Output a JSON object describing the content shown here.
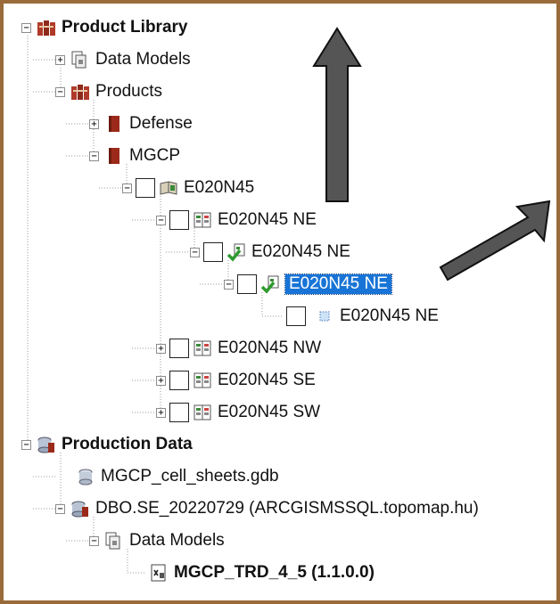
{
  "tree": {
    "items": [
      {
        "label": "Product Library",
        "expander": "−",
        "icon": "library-icon"
      },
      {
        "label": "Data Models",
        "expander": "+",
        "icon": "data-models-icon"
      },
      {
        "label": "Products",
        "expander": "−",
        "icon": "library-icon"
      },
      {
        "label": "Defense",
        "expander": "+",
        "icon": "book-icon"
      },
      {
        "label": "MGCP",
        "expander": "−",
        "icon": "book-icon"
      },
      {
        "label": "E020N45",
        "expander": "−",
        "icon": "series-book-icon",
        "checked": false
      },
      {
        "label": "E020N45 NE",
        "expander": "−",
        "icon": "map-sheet-icon",
        "checked": false
      },
      {
        "label": "E020N45 NE",
        "expander": "−",
        "icon": "instance-check-icon",
        "checked": false
      },
      {
        "label": "E020N45 NE",
        "expander": "−",
        "icon": "instance-check-icon",
        "checked": false,
        "selected": true
      },
      {
        "label": "E020N45 NE",
        "expander": "",
        "icon": "dotted-square-icon",
        "checked": false
      },
      {
        "label": "E020N45 NW",
        "expander": "+",
        "icon": "map-sheet-icon",
        "checked": false
      },
      {
        "label": "E020N45 SE",
        "expander": "+",
        "icon": "map-sheet-icon",
        "checked": false
      },
      {
        "label": "E020N45 SW",
        "expander": "+",
        "icon": "map-sheet-icon",
        "checked": false
      },
      {
        "label": "Production Data",
        "expander": "−",
        "icon": "database-stack-icon"
      },
      {
        "label": "MGCP_cell_sheets.gdb",
        "expander": "",
        "icon": "geodatabase-icon"
      },
      {
        "label": "DBO.SE_20220729 (ARCGISMSSQL.topomap.hu)",
        "expander": "−",
        "icon": "database-stack-icon"
      },
      {
        "label": "Data Models",
        "expander": "−",
        "icon": "data-models-icon"
      },
      {
        "label": "MGCP_TRD_4_5 (1.1.0.0)",
        "expander": "",
        "icon": "xml-model-icon"
      }
    ]
  },
  "colors": {
    "frame": "#9a6b3a",
    "selection": "#1874d6",
    "arrow_fill": "#555555",
    "book_red": "#9b2a1a",
    "check_green": "#2f9a2f"
  }
}
